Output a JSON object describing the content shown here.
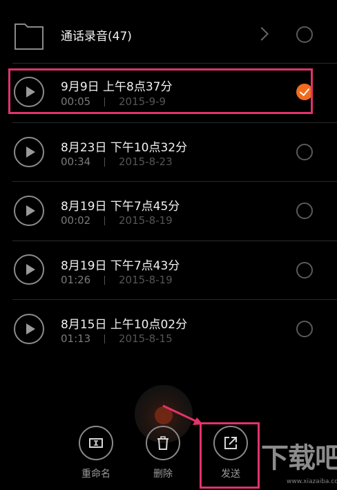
{
  "folder": {
    "label": "通话录音(47)"
  },
  "recordings": [
    {
      "title": "9月9日 上午8点37分",
      "duration": "00:05",
      "date": "2015-9-9",
      "selected": true
    },
    {
      "title": "8月23日 下午10点32分",
      "duration": "00:34",
      "date": "2015-8-23",
      "selected": false
    },
    {
      "title": "8月19日 下午7点45分",
      "duration": "00:02",
      "date": "2015-8-19",
      "selected": false
    },
    {
      "title": "8月19日 下午7点43分",
      "duration": "01:26",
      "date": "2015-8-19",
      "selected": false
    },
    {
      "title": "8月15日 上午10点02分",
      "duration": "01:13",
      "date": "2015-8-15",
      "selected": false
    }
  ],
  "actions": {
    "rename": "重命名",
    "delete": "删除",
    "send": "发送"
  },
  "watermark": {
    "main": "下载吧",
    "sub": "www.xiazaiba.com"
  },
  "colors": {
    "accent": "#f26b1d",
    "highlight": "#e2336b",
    "background": "#000000"
  }
}
